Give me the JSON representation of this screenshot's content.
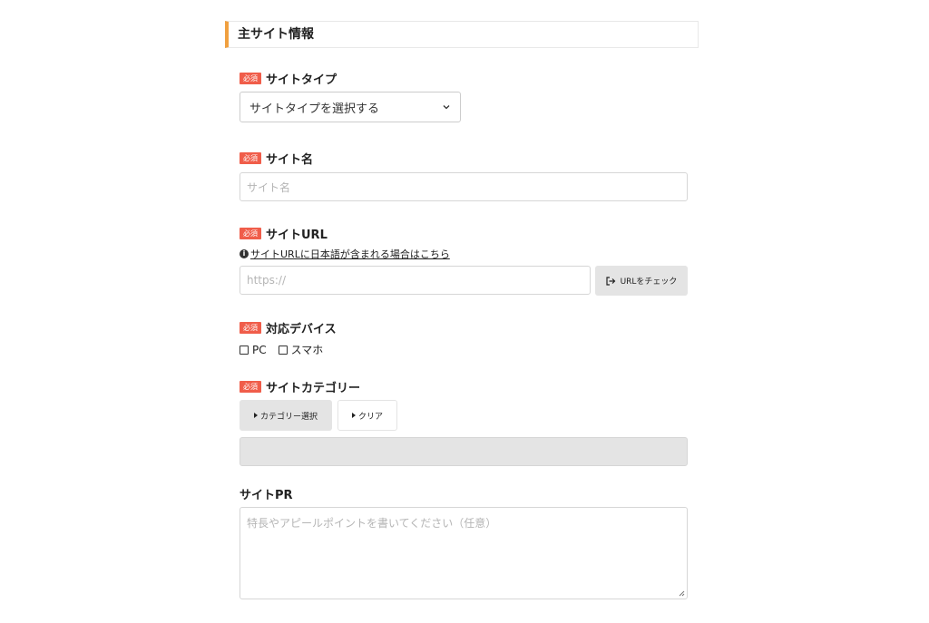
{
  "section": {
    "title": "主サイト情報"
  },
  "required_badge": "必須",
  "site_type": {
    "label": "サイトタイプ",
    "selected": "サイトタイプを選択する"
  },
  "site_name": {
    "label": "サイト名",
    "placeholder": "サイト名"
  },
  "site_url": {
    "label": "サイトURL",
    "help_text": "サイトURLに日本語が含まれる場合はこちら",
    "placeholder": "https://",
    "check_button": "URLをチェック"
  },
  "devices": {
    "label": "対応デバイス",
    "options": [
      "PC",
      "スマホ"
    ]
  },
  "category": {
    "label": "サイトカテゴリー",
    "select_button": "カテゴリー選択",
    "clear_button": "クリア"
  },
  "site_pr": {
    "label": "サイトPR",
    "placeholder": "特長やアピールポイントを書いてください（任意）"
  },
  "colors": {
    "accent": "#f0a040",
    "required": "#f05d4a",
    "button_bg": "#e4e4e4"
  }
}
